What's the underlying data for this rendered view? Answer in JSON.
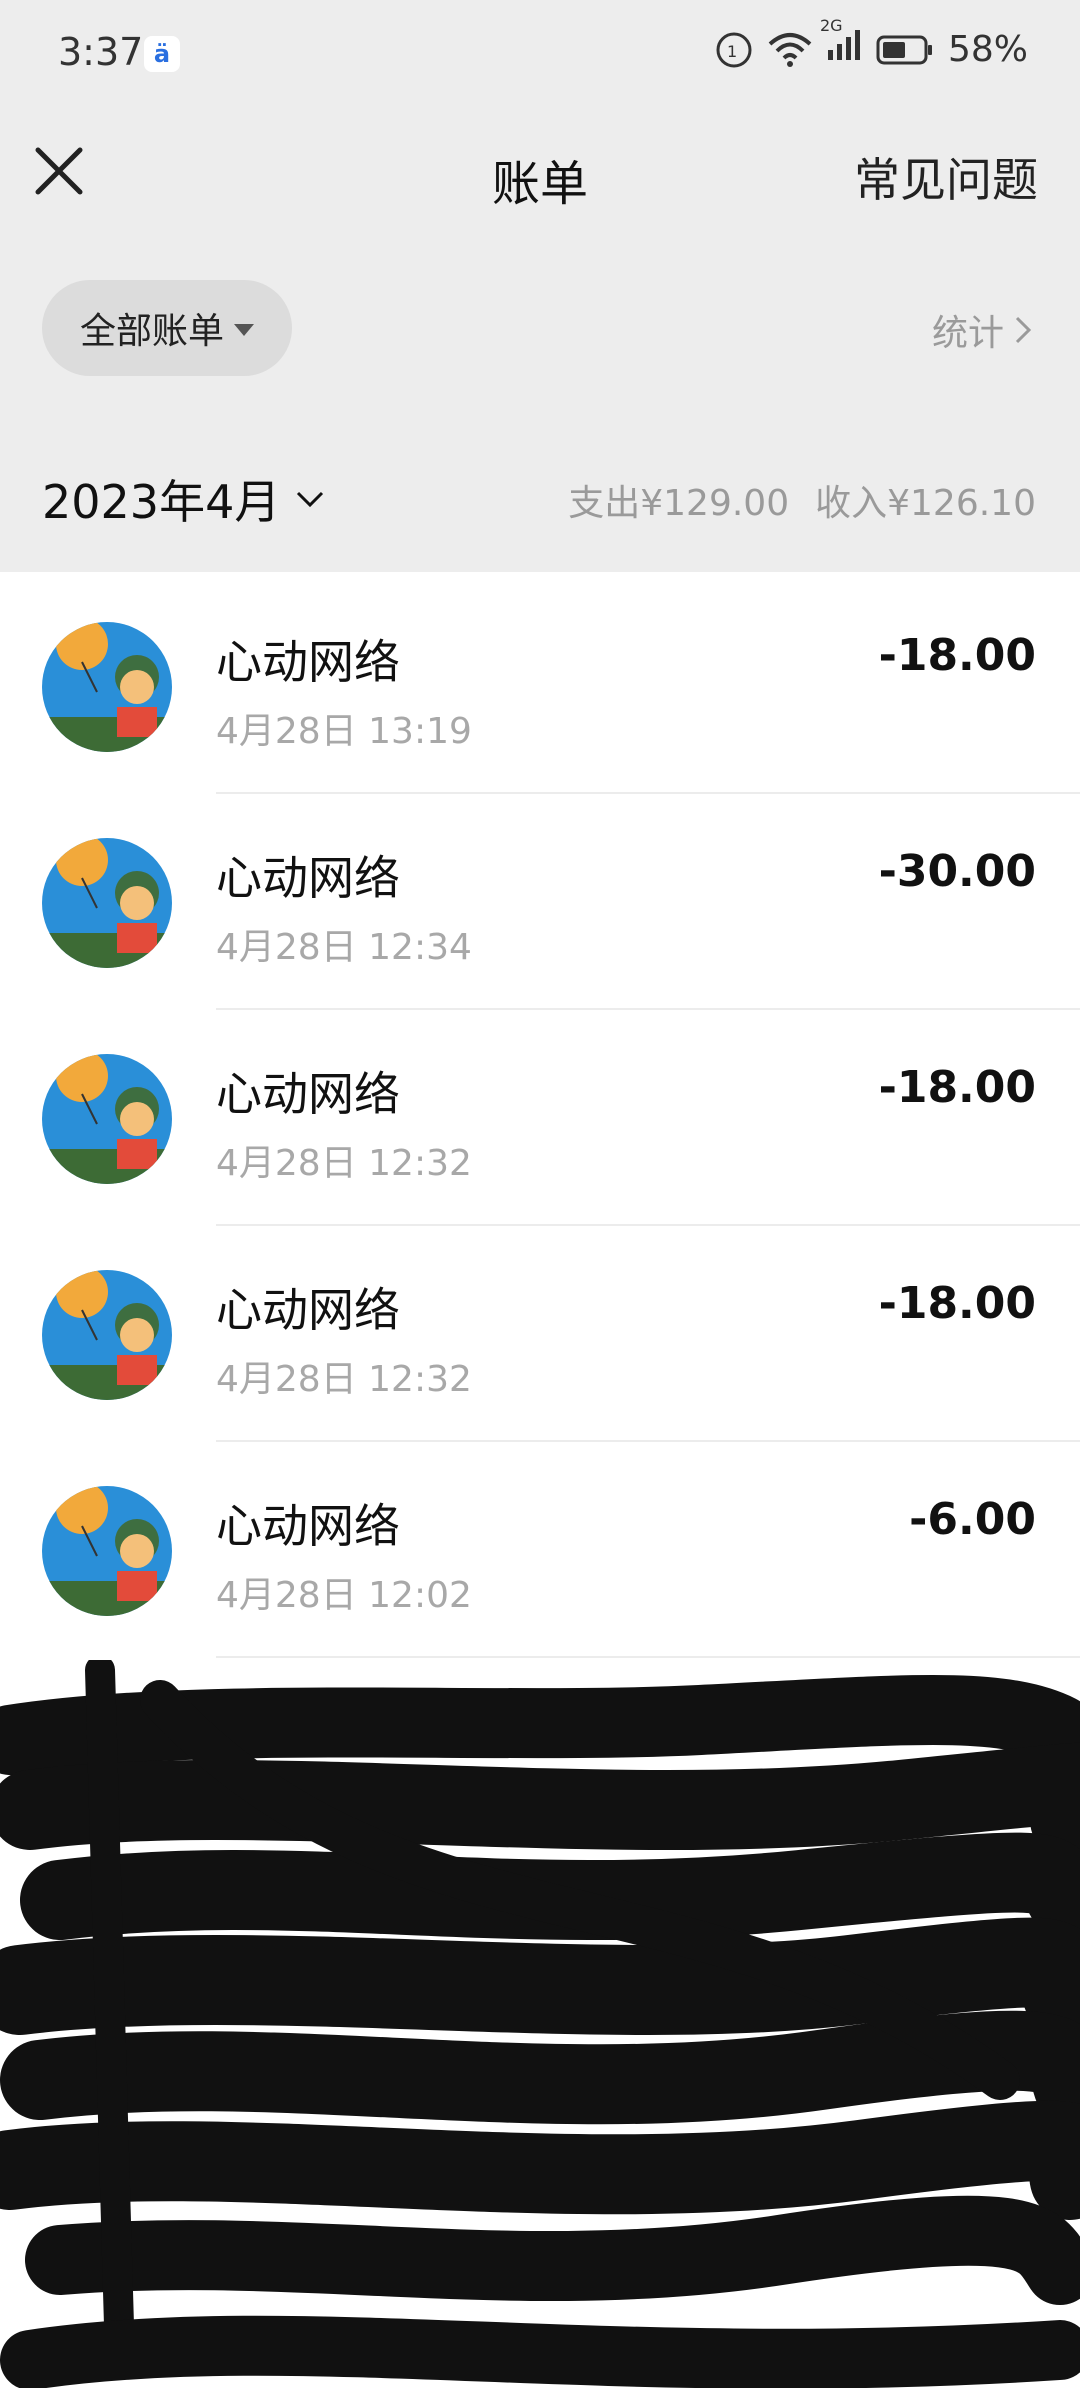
{
  "status_bar": {
    "time": "3:37",
    "network": "2G",
    "battery": "58%",
    "icons": [
      "baidu-icon",
      "sync-icon",
      "wifi-icon",
      "signal-icon",
      "battery-icon"
    ]
  },
  "header": {
    "title": "账单",
    "faq_label": "常见问题",
    "close_icon": "close-icon"
  },
  "filter": {
    "all_bills_label": "全部账单",
    "stats_label": "统计"
  },
  "month": {
    "label": "2023年4月",
    "expense": "支出¥129.00",
    "income": "收入¥126.10"
  },
  "transactions": [
    {
      "merchant": "心动网络",
      "time": "4月28日 13:19",
      "amount": "-18.00"
    },
    {
      "merchant": "心动网络",
      "time": "4月28日 12:34",
      "amount": "-30.00"
    },
    {
      "merchant": "心动网络",
      "time": "4月28日 12:32",
      "amount": "-18.00"
    },
    {
      "merchant": "心动网络",
      "time": "4月28日 12:32",
      "amount": "-18.00"
    },
    {
      "merchant": "心动网络",
      "time": "4月28日 12:02",
      "amount": "-6.00"
    }
  ],
  "colors": {
    "header_bg": "#ededed",
    "list_bg": "#ffffff",
    "muted_text": "#a8a8a8"
  }
}
